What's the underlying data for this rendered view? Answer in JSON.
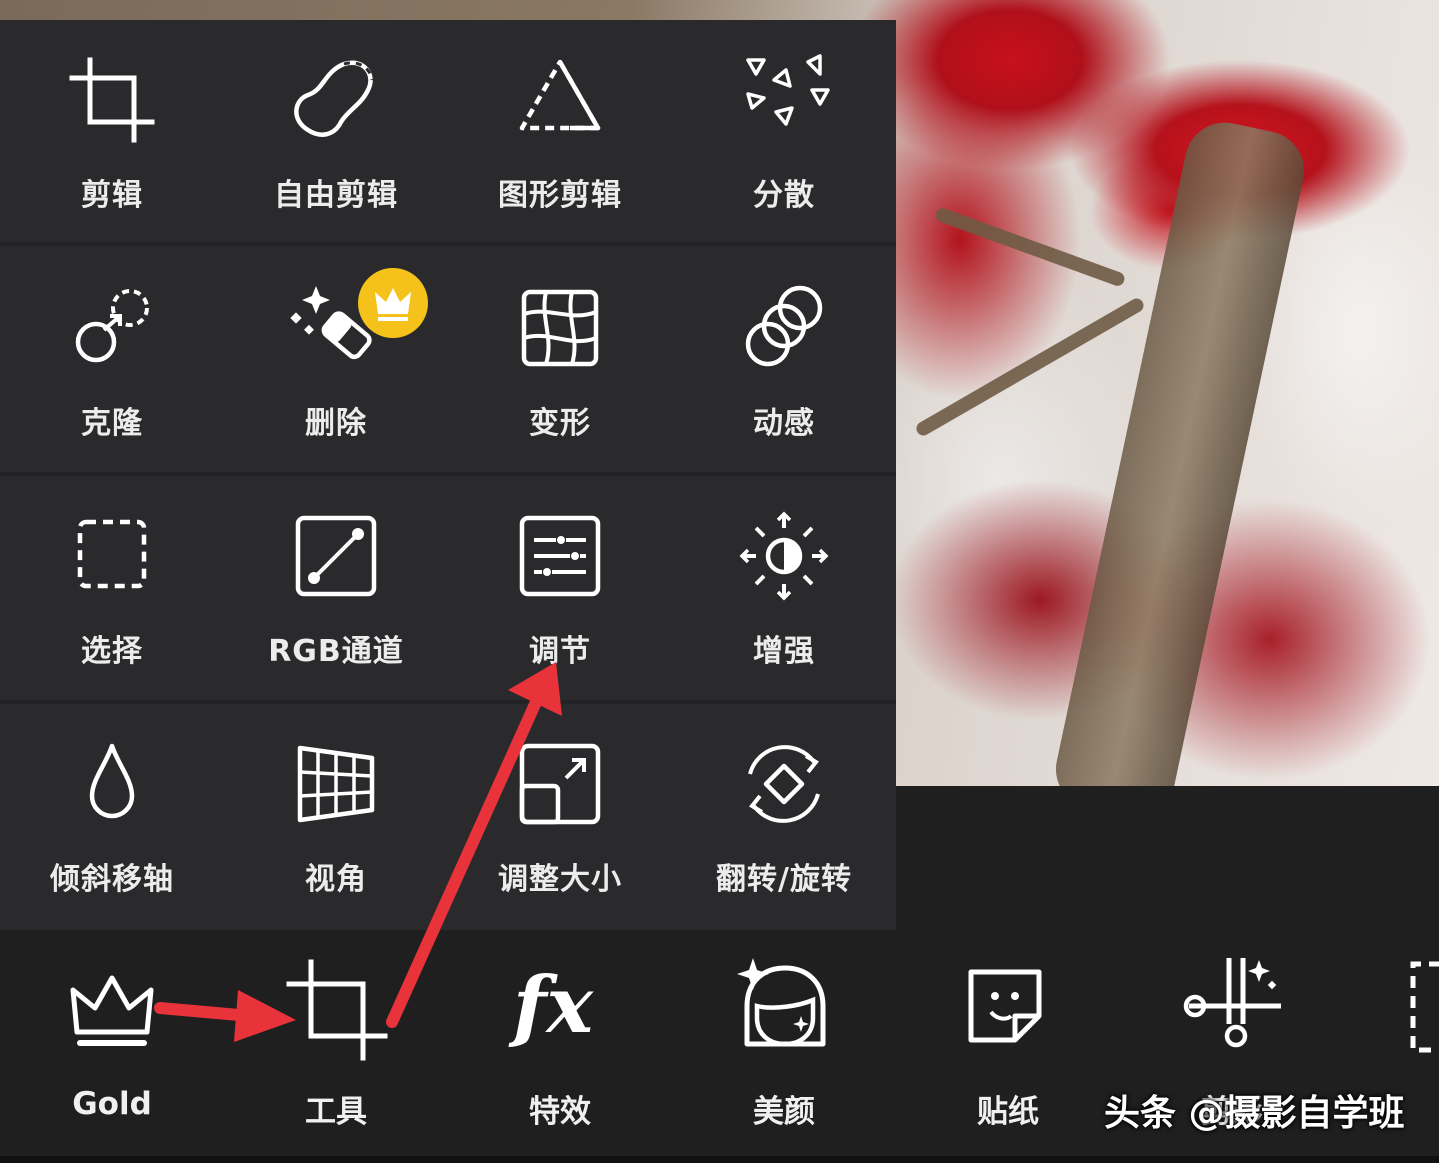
{
  "tools_grid": [
    {
      "label": "剪辑",
      "icon": "crop-icon"
    },
    {
      "label": "自由剪辑",
      "icon": "free-crop-icon"
    },
    {
      "label": "图形剪辑",
      "icon": "shape-crop-icon"
    },
    {
      "label": "分散",
      "icon": "dispersion-icon"
    },
    {
      "label": "克隆",
      "icon": "clone-icon"
    },
    {
      "label": "删除",
      "icon": "remove-eraser-icon"
    },
    {
      "label": "变形",
      "icon": "warp-icon"
    },
    {
      "label": "动感",
      "icon": "motion-icon"
    },
    {
      "label": "选择",
      "icon": "select-icon"
    },
    {
      "label": "RGB通道",
      "icon": "rgb-channel-icon"
    },
    {
      "label": "调节",
      "icon": "adjust-icon"
    },
    {
      "label": "增强",
      "icon": "enhance-icon"
    },
    {
      "label": "倾斜移轴",
      "icon": "tilt-shift-icon"
    },
    {
      "label": "视角",
      "icon": "perspective-icon"
    },
    {
      "label": "调整大小",
      "icon": "resize-icon"
    },
    {
      "label": "翻转/旋转",
      "icon": "flip-rotate-icon"
    }
  ],
  "bottom_nav": [
    {
      "label": "Gold",
      "icon": "crown-icon"
    },
    {
      "label": "工具",
      "icon": "tools-crop-icon"
    },
    {
      "label": "特效",
      "icon": "fx-icon"
    },
    {
      "label": "美颜",
      "icon": "beautify-face-icon"
    },
    {
      "label": "贴纸",
      "icon": "sticker-icon"
    },
    {
      "label": "剪影",
      "icon": "cutout-scissors-icon"
    }
  ],
  "watermark": "头条 @摄影自学班",
  "colors": {
    "panel_bg": "#2a2a2c",
    "bottom_bar_bg": "#1f1f1f",
    "icon_stroke": "#ffffff",
    "premium_badge": "#f4c21a",
    "annotation_arrow": "#e8333a"
  }
}
